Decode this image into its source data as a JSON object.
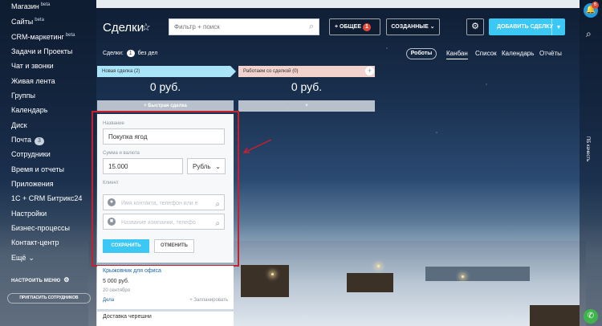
{
  "sidebar": {
    "items": [
      {
        "label": "Магазин",
        "sup": "beta"
      },
      {
        "label": "Сайты",
        "sup": "beta"
      },
      {
        "label": "CRM-маркетинг",
        "sup": "beta"
      },
      {
        "label": "Задачи и Проекты"
      },
      {
        "label": "Чат и звонки"
      },
      {
        "label": "Живая лента"
      },
      {
        "label": "Группы"
      },
      {
        "label": "Календарь"
      },
      {
        "label": "Диск"
      },
      {
        "label": "Почта",
        "badge": "3"
      },
      {
        "label": "Сотрудники"
      },
      {
        "label": "Время и отчеты"
      },
      {
        "label": "Приложения"
      },
      {
        "label": "1С + CRM Битрикс24"
      },
      {
        "label": "Настройки"
      },
      {
        "label": "Бизнес-процессы"
      },
      {
        "label": "Контакт-центр"
      },
      {
        "label": "Ещё"
      }
    ],
    "configure_menu": "НАСТРОИТЬ МЕНЮ",
    "invite": "ПРИГЛАСИТЬ СОТРУДНИКОВ"
  },
  "rail": {
    "notifications": "6",
    "vertical_text": "ПБ качесть"
  },
  "header": {
    "title": "Сделки",
    "filter_placeholder": "Фильтр + поиск",
    "general_label": "ОБЩЕЕ",
    "general_badge": "1",
    "created_label": "СОЗДАННЫЕ",
    "add_label": "ДОБАВИТЬ СДЕЛКУ"
  },
  "subheader": {
    "deals_prefix": "Сделки:",
    "deals_count": "1",
    "deals_suffix": "без дел",
    "robots": "Роботы",
    "tabs": [
      "Канбан",
      "Список",
      "Календарь",
      "Отчёты"
    ]
  },
  "columns": [
    {
      "title": "Новая сделка",
      "count": "(2)",
      "sum": "0 руб.",
      "quick": "+ Быстрая сделка"
    },
    {
      "title": "Работаем со сделкой",
      "count": "(0)",
      "sum": "0 руб.",
      "quick": "+"
    }
  ],
  "form": {
    "name_label": "Название",
    "name_value": "Покупка ягод",
    "amount_label": "Сумма и валюта",
    "amount_value": "15.000",
    "currency": "Рубль",
    "client_label": "Клиент",
    "contact_placeholder": "Имя контакта, телефон или e",
    "company_placeholder": "Название компании, телефо",
    "save": "СОХРАНИТЬ",
    "cancel": "ОТМЕНИТЬ"
  },
  "deals": [
    {
      "title": "Крыжовник для офиса",
      "sum": "5 000 руб.",
      "date": "20 сентября",
      "link": "Дела",
      "plan": "+ Запланировать"
    },
    {
      "title": "Доставка черешни"
    }
  ],
  "colors": {
    "accent": "#3bc8f5",
    "highlight": "#c8202b",
    "stage1": "#a9e4f8",
    "stage2": "#f2d2cd"
  }
}
